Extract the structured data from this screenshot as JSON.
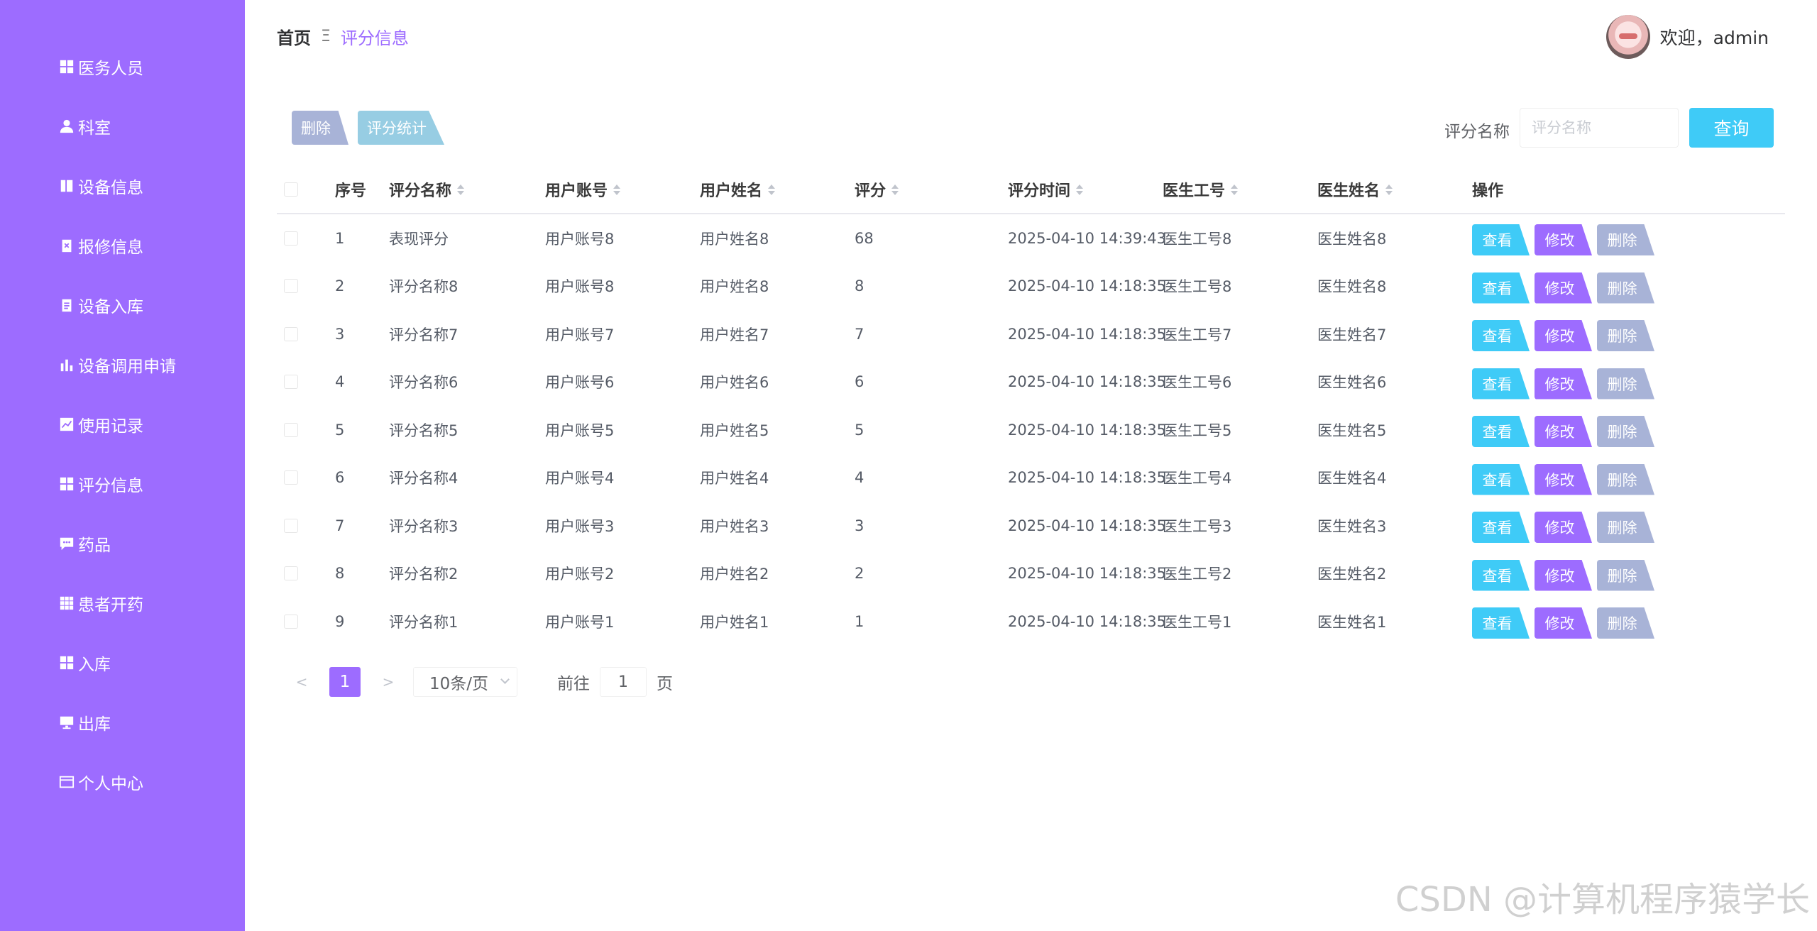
{
  "sidebar": {
    "items": [
      {
        "label": "医务人员",
        "icon": "grid-icon"
      },
      {
        "label": "科室",
        "icon": "user-icon"
      },
      {
        "label": "设备信息",
        "icon": "book-icon"
      },
      {
        "label": "报修信息",
        "icon": "clipboard-x-icon"
      },
      {
        "label": "设备入库",
        "icon": "clipboard-icon"
      },
      {
        "label": "设备调用申请",
        "icon": "bar-chart-icon"
      },
      {
        "label": "使用记录",
        "icon": "line-chart-icon"
      },
      {
        "label": "评分信息",
        "icon": "grid-icon"
      },
      {
        "label": "药品",
        "icon": "comment-icon"
      },
      {
        "label": "患者开药",
        "icon": "grid-3x3-icon"
      },
      {
        "label": "入库",
        "icon": "grid-icon"
      },
      {
        "label": "出库",
        "icon": "monitor-icon"
      },
      {
        "label": "个人中心",
        "icon": "card-icon"
      }
    ]
  },
  "header": {
    "breadcrumb_home": "首页",
    "breadcrumb_sep": "Ξ",
    "breadcrumb_current": "评分信息",
    "welcome": "欢迎，admin"
  },
  "toolbar": {
    "delete_label": "删除",
    "stats_label": "评分统计",
    "search_label": "评分名称",
    "search_placeholder": "评分名称",
    "search_value": "",
    "query_label": "查询"
  },
  "table": {
    "columns": [
      "序号",
      "评分名称",
      "用户账号",
      "用户姓名",
      "评分",
      "评分时间",
      "医生工号",
      "医生姓名",
      "操作"
    ],
    "rows": [
      {
        "idx": "1",
        "name": "表现评分",
        "account": "用户账号8",
        "username": "用户姓名8",
        "score": "68",
        "time": "2025-04-10 14:39:43",
        "doc_no": "医生工号8",
        "doc_name": "医生姓名8"
      },
      {
        "idx": "2",
        "name": "评分名称8",
        "account": "用户账号8",
        "username": "用户姓名8",
        "score": "8",
        "time": "2025-04-10 14:18:35",
        "doc_no": "医生工号8",
        "doc_name": "医生姓名8"
      },
      {
        "idx": "3",
        "name": "评分名称7",
        "account": "用户账号7",
        "username": "用户姓名7",
        "score": "7",
        "time": "2025-04-10 14:18:35",
        "doc_no": "医生工号7",
        "doc_name": "医生姓名7"
      },
      {
        "idx": "4",
        "name": "评分名称6",
        "account": "用户账号6",
        "username": "用户姓名6",
        "score": "6",
        "time": "2025-04-10 14:18:35",
        "doc_no": "医生工号6",
        "doc_name": "医生姓名6"
      },
      {
        "idx": "5",
        "name": "评分名称5",
        "account": "用户账号5",
        "username": "用户姓名5",
        "score": "5",
        "time": "2025-04-10 14:18:35",
        "doc_no": "医生工号5",
        "doc_name": "医生姓名5"
      },
      {
        "idx": "6",
        "name": "评分名称4",
        "account": "用户账号4",
        "username": "用户姓名4",
        "score": "4",
        "time": "2025-04-10 14:18:35",
        "doc_no": "医生工号4",
        "doc_name": "医生姓名4"
      },
      {
        "idx": "7",
        "name": "评分名称3",
        "account": "用户账号3",
        "username": "用户姓名3",
        "score": "3",
        "time": "2025-04-10 14:18:35",
        "doc_no": "医生工号3",
        "doc_name": "医生姓名3"
      },
      {
        "idx": "8",
        "name": "评分名称2",
        "account": "用户账号2",
        "username": "用户姓名2",
        "score": "2",
        "time": "2025-04-10 14:18:35",
        "doc_no": "医生工号2",
        "doc_name": "医生姓名2"
      },
      {
        "idx": "9",
        "name": "评分名称1",
        "account": "用户账号1",
        "username": "用户姓名1",
        "score": "1",
        "time": "2025-04-10 14:18:35",
        "doc_no": "医生工号1",
        "doc_name": "医生姓名1"
      }
    ],
    "actions": {
      "view": "查看",
      "edit": "修改",
      "delete": "删除"
    }
  },
  "pagination": {
    "prev": "<",
    "current_page": "1",
    "next": ">",
    "page_size": "10条/页",
    "goto_prefix": "前往",
    "goto_value": "1",
    "goto_suffix": "页"
  },
  "watermark": "CSDN @计算机程序猿学长",
  "colors": {
    "sidebar": "#9d6cff",
    "primary": "#9d6cff",
    "info": "#3fcbf7",
    "muted": "#a8b3d7",
    "stats": "#97cde3"
  }
}
